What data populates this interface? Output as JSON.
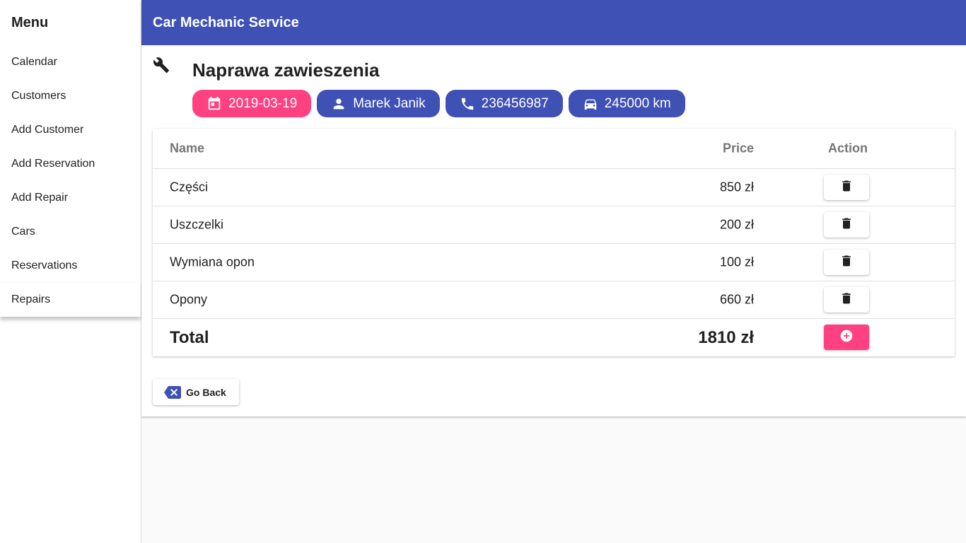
{
  "sidebar": {
    "title": "Menu",
    "items": [
      {
        "label": "Calendar"
      },
      {
        "label": "Customers"
      },
      {
        "label": "Add Customer"
      },
      {
        "label": "Add Reservation"
      },
      {
        "label": "Add Repair"
      },
      {
        "label": "Cars"
      },
      {
        "label": "Reservations"
      },
      {
        "label": "Repairs"
      }
    ],
    "active": "Repairs"
  },
  "appbar": {
    "title": "Car Mechanic Service"
  },
  "repair": {
    "title": "Naprawa zawieszenia",
    "icon": "wrench-icon",
    "chips": {
      "date": {
        "label": "2019-03-19",
        "icon": "calendar-icon",
        "color": "#ff4081"
      },
      "customer": {
        "label": "Marek Janik",
        "icon": "person-icon",
        "color": "#3f51b5"
      },
      "phone": {
        "label": "236456987",
        "icon": "phone-icon",
        "color": "#3f51b5"
      },
      "mileage": {
        "label": "245000 km",
        "icon": "car-icon",
        "color": "#3f51b5"
      }
    }
  },
  "table": {
    "headers": {
      "name": "Name",
      "price": "Price",
      "action": "Action"
    },
    "rows": [
      {
        "name": "Części",
        "price": "850 zł"
      },
      {
        "name": "Uszczelki",
        "price": "200 zł"
      },
      {
        "name": "Wymiana opon",
        "price": "100 zł"
      },
      {
        "name": "Opony",
        "price": "660 zł"
      }
    ],
    "total": {
      "label": "Total",
      "price": "1810 zł"
    }
  },
  "go_back": {
    "label": "Go Back",
    "icon": "backspace-icon"
  },
  "colors": {
    "primary": "#3f51b5",
    "accent": "#ff4081"
  }
}
